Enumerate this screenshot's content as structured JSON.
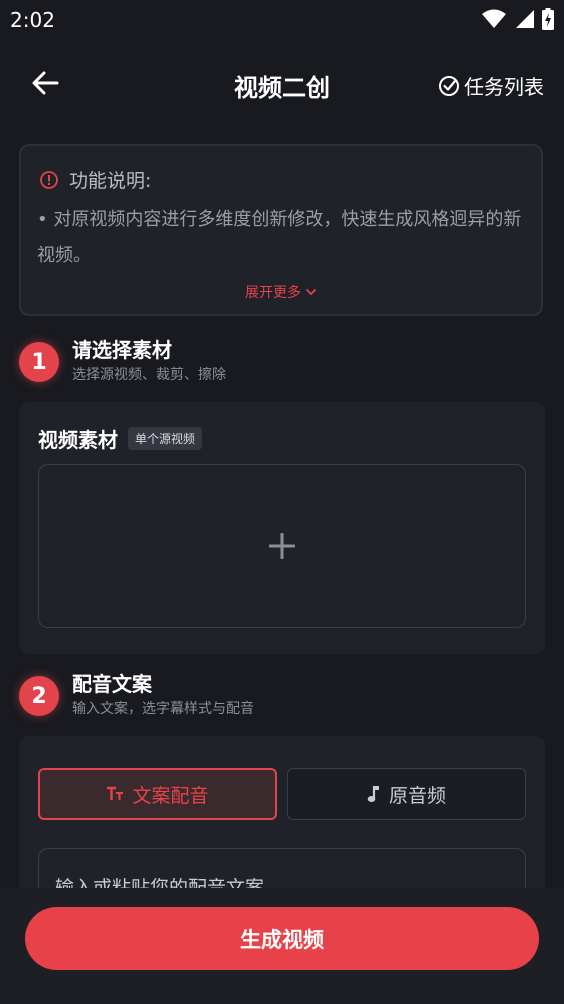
{
  "status_bar": {
    "time": "2:02",
    "icons": [
      "wifi-icon",
      "signal-icon",
      "battery-charging-icon"
    ]
  },
  "header": {
    "title": "视频二创",
    "task_list_label": "任务列表",
    "icons": [
      "back-arrow-icon",
      "check-circle-icon"
    ]
  },
  "info": {
    "title": "功能说明:",
    "text": "• 对原视频内容进行多维度创新修改，快速生成风格迥异的新视频。",
    "expand_label": "展开更多",
    "icons": [
      "info-icon",
      "chevron-down-icon"
    ]
  },
  "step1": {
    "number": "1",
    "title": "请选择素材",
    "subtitle": "选择源视频、裁剪、擦除"
  },
  "material": {
    "title": "视频素材",
    "tag": "单个源视频",
    "icons": [
      "plus-icon"
    ]
  },
  "step2": {
    "number": "2",
    "title": "配音文案",
    "subtitle": "输入文案，选字幕样式与配音"
  },
  "audio_tabs": {
    "script_dub_label": "文案配音",
    "original_audio_label": "原音频",
    "icons": [
      "text-size-icon",
      "music-note-icon"
    ]
  },
  "script_input": {
    "placeholder": "输入或粘贴您的配音文案"
  },
  "footer": {
    "generate_label": "生成视频"
  },
  "colors": {
    "background": "#181a1f",
    "card": "#1f2228",
    "accent": "#e3434a",
    "text_secondary": "#8b8f97"
  }
}
